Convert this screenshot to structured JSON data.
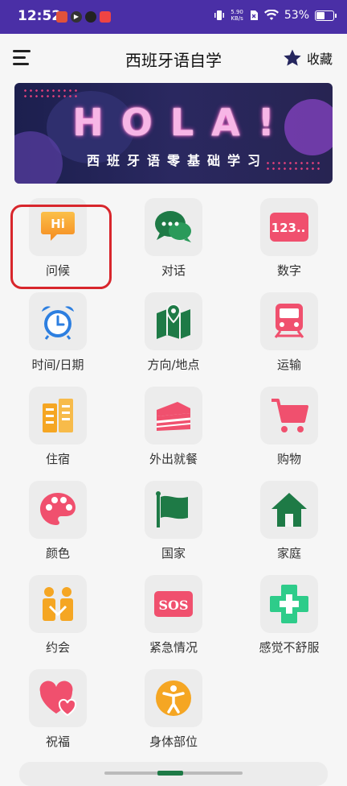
{
  "status_bar": {
    "time": "12:52",
    "notifications": [
      "app-notification-icon",
      "play-icon",
      "app-notification-icon",
      "app-notification-icon"
    ],
    "net_speed_value": "5.90",
    "net_speed_unit": "KB/s",
    "battery": "53%"
  },
  "header": {
    "title": "西班牙语自学",
    "favorite_label": "收藏"
  },
  "banner": {
    "headline": "HOLA!",
    "subtitle": "西班牙语零基础学习"
  },
  "categories": [
    {
      "label": "问候",
      "icon": "hi-chat-bubble-icon",
      "color": "#f5a623"
    },
    {
      "label": "对话",
      "icon": "chat-bubbles-icon",
      "color": "#1e7a46"
    },
    {
      "label": "数字",
      "icon": "numbers-123-icon",
      "color": "#f0506e"
    },
    {
      "label": "时间/日期",
      "icon": "alarm-clock-icon",
      "color": "#2d7fe0"
    },
    {
      "label": "方向/地点",
      "icon": "map-location-icon",
      "color": "#1e7a46"
    },
    {
      "label": "运输",
      "icon": "train-icon",
      "color": "#f0506e"
    },
    {
      "label": "住宿",
      "icon": "buildings-icon",
      "color": "#f5a623"
    },
    {
      "label": "外出就餐",
      "icon": "cake-icon",
      "color": "#f0506e"
    },
    {
      "label": "购物",
      "icon": "shopping-cart-icon",
      "color": "#f0506e"
    },
    {
      "label": "颜色",
      "icon": "palette-icon",
      "color": "#f0506e"
    },
    {
      "label": "国家",
      "icon": "flag-icon",
      "color": "#1e7a46"
    },
    {
      "label": "家庭",
      "icon": "house-icon",
      "color": "#1e7a46"
    },
    {
      "label": "约会",
      "icon": "couple-icon",
      "color": "#f5a623"
    },
    {
      "label": "紧急情况",
      "icon": "sos-icon",
      "color": "#f0506e"
    },
    {
      "label": "感觉不舒服",
      "icon": "medical-cross-icon",
      "color": "#2ecc8a"
    },
    {
      "label": "祝福",
      "icon": "hearts-icon",
      "color": "#f0506e"
    },
    {
      "label": "身体部位",
      "icon": "person-body-icon",
      "color": "#f5a623"
    }
  ]
}
